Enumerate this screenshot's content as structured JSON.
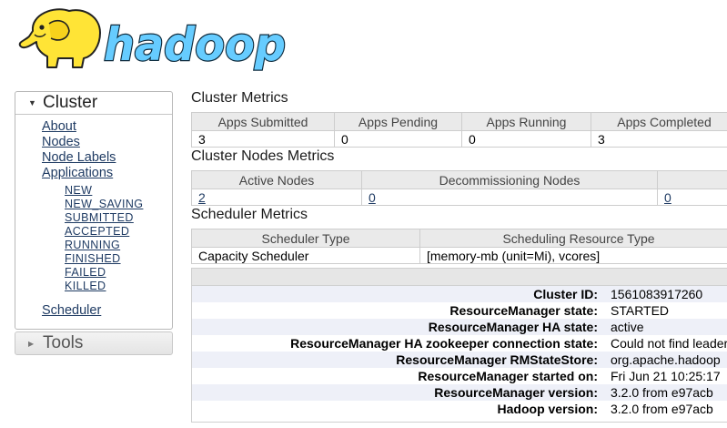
{
  "logo": {
    "text": "hadoop"
  },
  "sidebar": {
    "cluster": {
      "title": "Cluster",
      "links": [
        "About",
        "Nodes",
        "Node Labels",
        "Applications"
      ],
      "app_states": [
        "NEW",
        "NEW_SAVING",
        "SUBMITTED",
        "ACCEPTED",
        "RUNNING",
        "FINISHED",
        "FAILED",
        "KILLED"
      ],
      "scheduler": "Scheduler"
    },
    "tools": {
      "title": "Tools"
    }
  },
  "cluster_metrics": {
    "title": "Cluster Metrics",
    "headers": [
      "Apps Submitted",
      "Apps Pending",
      "Apps Running",
      "Apps Completed"
    ],
    "values": [
      "3",
      "0",
      "0",
      "3"
    ]
  },
  "nodes_metrics": {
    "title": "Cluster Nodes Metrics",
    "headers": [
      "Active Nodes",
      "Decommissioning Nodes",
      ""
    ],
    "values": [
      "2",
      "0",
      "0"
    ]
  },
  "scheduler_metrics": {
    "title": "Scheduler Metrics",
    "headers": [
      "Scheduler Type",
      "Scheduling Resource Type"
    ],
    "values": [
      "Capacity Scheduler",
      "[memory-mb (unit=Mi), vcores]"
    ]
  },
  "cluster_info": [
    {
      "key": "Cluster ID:",
      "value": "1561083917260"
    },
    {
      "key": "ResourceManager state:",
      "value": "STARTED"
    },
    {
      "key": "ResourceManager HA state:",
      "value": "active"
    },
    {
      "key": "ResourceManager HA zookeeper connection state:",
      "value": "Could not find leader"
    },
    {
      "key": "ResourceManager RMStateStore:",
      "value": "org.apache.hadoop"
    },
    {
      "key": "ResourceManager started on:",
      "value": "Fri Jun 21 10:25:17"
    },
    {
      "key": "ResourceManager version:",
      "value": "3.2.0 from e97acb"
    },
    {
      "key": "Hadoop version:",
      "value": "3.2.0 from e97acb"
    }
  ],
  "colors": {
    "link": "#1f3b63",
    "logo_yellow": "#ffe436",
    "logo_blue": "#66ccff"
  }
}
